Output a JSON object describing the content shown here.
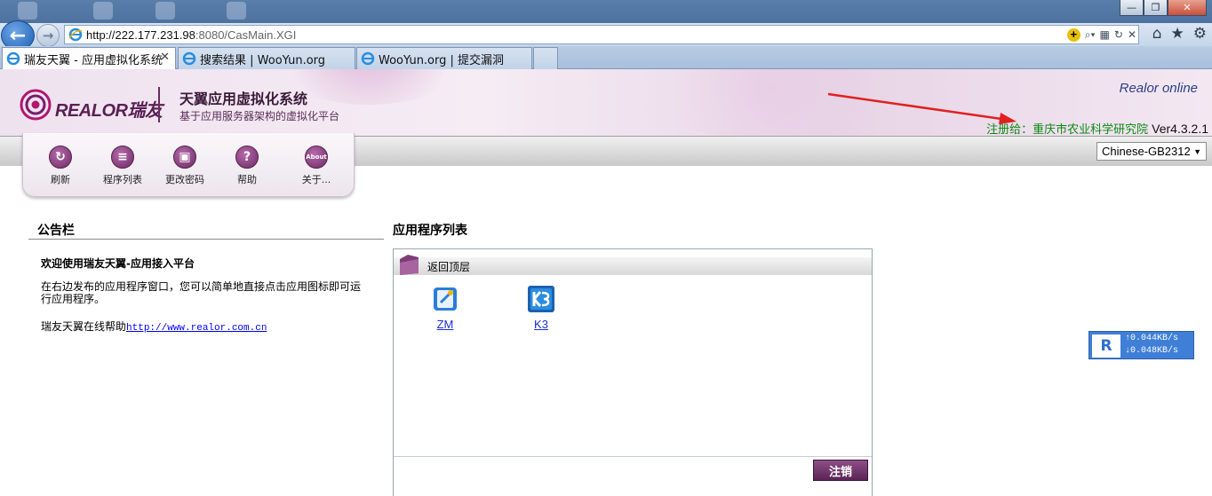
{
  "browser": {
    "url_host": "http://222.177.231.98",
    "url_rest": ":8080/CasMain.XGI",
    "tabs": [
      {
        "label": "瑞友天翼 - 应用虚拟化系统",
        "active": true
      },
      {
        "label": "搜索结果 | WooYun.org",
        "active": false
      },
      {
        "label": "WooYun.org | 提交漏洞",
        "active": false
      }
    ],
    "tab_close": "✕",
    "window_buttons": {
      "minimize": "—",
      "maximize": "❐",
      "close": "✕"
    }
  },
  "header": {
    "logo_text": "REALOR瑞友",
    "title": "天翼应用虚拟化系统",
    "subtitle": "基于应用服务器架构的虚拟化平台",
    "online": "Realor online",
    "registered_label": "注册给：",
    "registered_org": "重庆市农业科学研究院",
    "version": "Ver4.3.2.1",
    "colors": {
      "brand": "#6a2b62",
      "registered": "#0a8a12",
      "arrow": "#e02020"
    }
  },
  "language": {
    "selected": "Chinese-GB2312"
  },
  "toolbar": {
    "items": [
      {
        "label": "刷新",
        "icon": "refresh-icon",
        "glyph": "↻"
      },
      {
        "label": "程序列表",
        "icon": "list-icon",
        "glyph": "≡"
      },
      {
        "label": "更改密码",
        "icon": "lock-icon",
        "glyph": "▣"
      },
      {
        "label": "帮助",
        "icon": "help-icon",
        "glyph": "?"
      },
      {
        "label": "关于...",
        "icon": "about-icon",
        "glyph": "About"
      }
    ]
  },
  "bulletin": {
    "title": "公告栏",
    "welcome": "欢迎使用瑞友天翼-应用接入平台",
    "description": "在右边发布的应用程序窗口，您可以简单地直接点击应用图标即可运行应用程序。",
    "help_prefix": "瑞友天翼在线帮助",
    "help_link": "http://www.realor.com.cn"
  },
  "apps": {
    "title": "应用程序列表",
    "back_label": "返回顶层",
    "items": [
      {
        "label": "ZM",
        "icon": "zm-app-icon"
      },
      {
        "label": "K3",
        "icon": "k3-app-icon"
      }
    ],
    "logout_label": "注销"
  },
  "speed": {
    "up": "↑0.044KB/s",
    "down": "↓0.048KB/s"
  }
}
